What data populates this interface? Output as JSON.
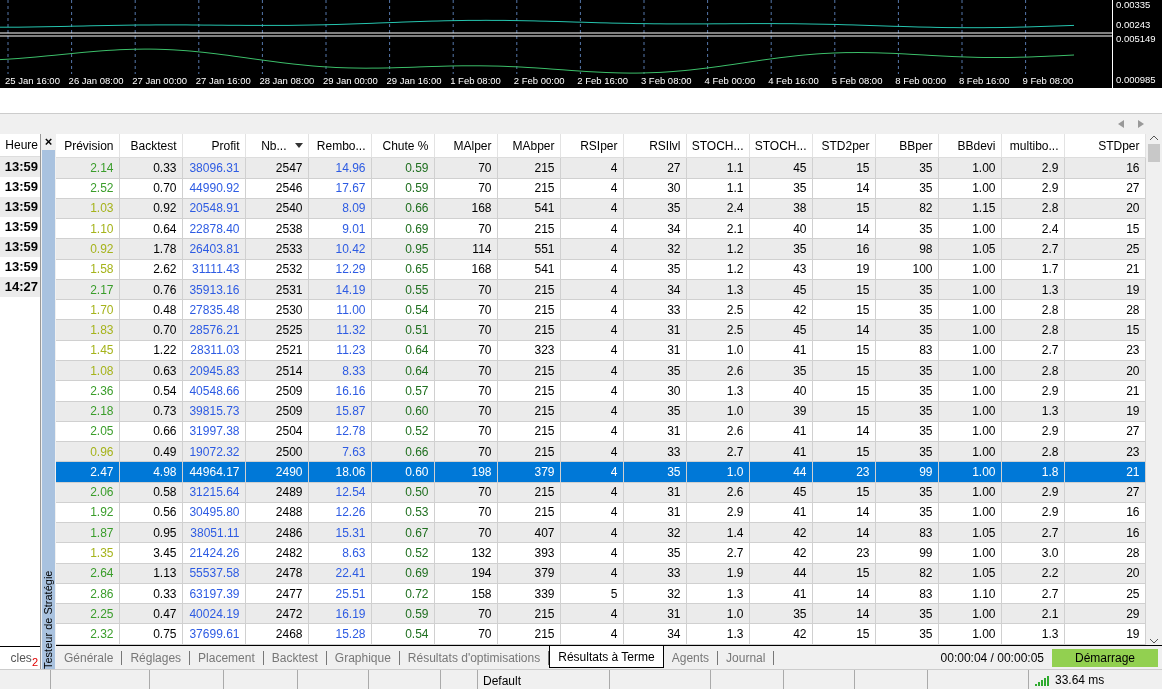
{
  "chart": {
    "time_labels": [
      "25 Jan 16:00",
      "26 Jan 08:00",
      "27 Jan 00:00",
      "27 Jan 16:00",
      "28 Jan 08:00",
      "29 Jan 00:00",
      "29 Jan 16:00",
      "1 Feb 08:00",
      "2 Feb 00:00",
      "2 Feb 16:00",
      "3 Feb 08:00",
      "4 Feb 00:00",
      "4 Feb 16:00",
      "5 Feb 08:00",
      "8 Feb 00:00",
      "8 Feb 16:00",
      "9 Feb 08:00"
    ],
    "upper_labels": [
      "0.00335",
      "0.00243"
    ],
    "lower_labels": [
      "0.005149",
      "0.000985"
    ]
  },
  "side_panel": {
    "header": "Heure",
    "times": [
      "13:59",
      "13:59",
      "13:59",
      "13:59",
      "13:59",
      "13:59",
      "14:27"
    ],
    "tab_label": "cles",
    "tab_badge": "2"
  },
  "tester": {
    "title": "Testeur de Stratégie",
    "close": "×"
  },
  "table": {
    "columns": [
      {
        "label": "Prévision",
        "sorted": false,
        "kind": "forecast"
      },
      {
        "label": "Backtest",
        "sorted": false,
        "kind": "plain"
      },
      {
        "label": "Profit",
        "sorted": false,
        "kind": "money"
      },
      {
        "label": "Nb...",
        "sorted": true,
        "kind": "plain"
      },
      {
        "label": "Rembo...",
        "sorted": false,
        "kind": "money"
      },
      {
        "label": "Chute %",
        "sorted": false,
        "kind": "ratio"
      },
      {
        "label": "MAlper",
        "sorted": false,
        "kind": "plain"
      },
      {
        "label": "MAbper",
        "sorted": false,
        "kind": "plain"
      },
      {
        "label": "RSIper",
        "sorted": false,
        "kind": "plain"
      },
      {
        "label": "RSIlvl",
        "sorted": false,
        "kind": "plain"
      },
      {
        "label": "STOCH...",
        "sorted": false,
        "kind": "plain"
      },
      {
        "label": "STOCH...",
        "sorted": false,
        "kind": "plain"
      },
      {
        "label": "STD2per",
        "sorted": false,
        "kind": "plain"
      },
      {
        "label": "BBper",
        "sorted": false,
        "kind": "plain"
      },
      {
        "label": "BBdevi",
        "sorted": false,
        "kind": "plain"
      },
      {
        "label": "multibo...",
        "sorted": false,
        "kind": "plain"
      },
      {
        "label": "STDper",
        "sorted": false,
        "kind": "plain"
      }
    ],
    "rows": [
      {
        "selected": false,
        "color": "#3a9d2a",
        "cells": [
          "2.14",
          "0.33",
          "38096.31",
          "2547",
          "14.96",
          "0.59",
          "70",
          "215",
          "4",
          "27",
          "1.1",
          "45",
          "15",
          "35",
          "1.00",
          "2.9",
          "16"
        ]
      },
      {
        "selected": false,
        "color": "#3a9d2a",
        "cells": [
          "2.52",
          "0.70",
          "44990.92",
          "2546",
          "17.67",
          "0.59",
          "70",
          "215",
          "4",
          "30",
          "1.1",
          "35",
          "14",
          "35",
          "1.00",
          "2.9",
          "27"
        ]
      },
      {
        "selected": false,
        "color": "#a5b31a",
        "cells": [
          "1.03",
          "0.92",
          "20548.91",
          "2540",
          "8.09",
          "0.66",
          "168",
          "541",
          "4",
          "35",
          "2.4",
          "38",
          "15",
          "82",
          "1.15",
          "2.8",
          "20"
        ]
      },
      {
        "selected": false,
        "color": "#a5b31a",
        "cells": [
          "1.10",
          "0.64",
          "22878.40",
          "2538",
          "9.01",
          "0.69",
          "70",
          "215",
          "4",
          "34",
          "2.1",
          "40",
          "14",
          "35",
          "1.00",
          "2.4",
          "15"
        ]
      },
      {
        "selected": false,
        "color": "#a5b31a",
        "cells": [
          "0.92",
          "1.78",
          "26403.81",
          "2533",
          "10.42",
          "0.95",
          "114",
          "551",
          "4",
          "32",
          "1.2",
          "35",
          "16",
          "98",
          "1.05",
          "2.7",
          "25"
        ]
      },
      {
        "selected": false,
        "color": "#a5b31a",
        "cells": [
          "1.58",
          "2.62",
          "31111.43",
          "2532",
          "12.29",
          "0.65",
          "168",
          "541",
          "4",
          "35",
          "1.2",
          "43",
          "19",
          "100",
          "1.00",
          "1.7",
          "21"
        ]
      },
      {
        "selected": false,
        "color": "#3a9d2a",
        "cells": [
          "2.17",
          "0.76",
          "35913.16",
          "2531",
          "14.19",
          "0.55",
          "70",
          "215",
          "4",
          "34",
          "1.3",
          "45",
          "15",
          "35",
          "1.00",
          "1.3",
          "19"
        ]
      },
      {
        "selected": false,
        "color": "#a5b31a",
        "cells": [
          "1.70",
          "0.48",
          "27835.48",
          "2530",
          "11.00",
          "0.54",
          "70",
          "215",
          "4",
          "33",
          "2.5",
          "42",
          "15",
          "35",
          "1.00",
          "2.8",
          "28"
        ]
      },
      {
        "selected": false,
        "color": "#a5b31a",
        "cells": [
          "1.83",
          "0.70",
          "28576.21",
          "2525",
          "11.32",
          "0.51",
          "70",
          "215",
          "4",
          "31",
          "2.5",
          "45",
          "14",
          "35",
          "1.00",
          "2.8",
          "15"
        ]
      },
      {
        "selected": false,
        "color": "#a5b31a",
        "cells": [
          "1.45",
          "1.22",
          "28311.03",
          "2521",
          "11.23",
          "0.64",
          "70",
          "323",
          "4",
          "31",
          "1.0",
          "41",
          "15",
          "83",
          "1.00",
          "2.7",
          "23"
        ]
      },
      {
        "selected": false,
        "color": "#a5b31a",
        "cells": [
          "1.08",
          "0.63",
          "20945.83",
          "2514",
          "8.33",
          "0.64",
          "70",
          "215",
          "4",
          "35",
          "2.6",
          "35",
          "15",
          "35",
          "1.00",
          "2.8",
          "20"
        ]
      },
      {
        "selected": false,
        "color": "#3a9d2a",
        "cells": [
          "2.36",
          "0.54",
          "40548.66",
          "2509",
          "16.16",
          "0.57",
          "70",
          "215",
          "4",
          "30",
          "1.3",
          "40",
          "15",
          "35",
          "1.00",
          "2.9",
          "21"
        ]
      },
      {
        "selected": false,
        "color": "#3a9d2a",
        "cells": [
          "2.18",
          "0.73",
          "39815.73",
          "2509",
          "15.87",
          "0.60",
          "70",
          "215",
          "4",
          "35",
          "1.0",
          "39",
          "15",
          "35",
          "1.00",
          "1.3",
          "19"
        ]
      },
      {
        "selected": false,
        "color": "#3a9d2a",
        "cells": [
          "2.05",
          "0.66",
          "31997.38",
          "2504",
          "12.78",
          "0.52",
          "70",
          "215",
          "4",
          "31",
          "2.6",
          "41",
          "14",
          "35",
          "1.00",
          "2.9",
          "27"
        ]
      },
      {
        "selected": false,
        "color": "#a5b31a",
        "cells": [
          "0.96",
          "0.49",
          "19072.32",
          "2500",
          "7.63",
          "0.66",
          "70",
          "215",
          "4",
          "33",
          "2.7",
          "41",
          "15",
          "35",
          "1.00",
          "2.8",
          "23"
        ]
      },
      {
        "selected": true,
        "cells": [
          "2.47",
          "4.98",
          "44964.17",
          "2490",
          "18.06",
          "0.60",
          "198",
          "379",
          "4",
          "35",
          "1.0",
          "44",
          "23",
          "99",
          "1.00",
          "1.8",
          "21"
        ]
      },
      {
        "selected": false,
        "color": "#3a9d2a",
        "cells": [
          "2.06",
          "0.58",
          "31215.64",
          "2489",
          "12.54",
          "0.50",
          "70",
          "215",
          "4",
          "31",
          "2.6",
          "45",
          "15",
          "35",
          "1.00",
          "2.9",
          "27"
        ]
      },
      {
        "selected": false,
        "color": "#3a9d2a",
        "cells": [
          "1.92",
          "0.56",
          "30495.80",
          "2488",
          "12.26",
          "0.53",
          "70",
          "215",
          "4",
          "31",
          "2.9",
          "41",
          "14",
          "35",
          "1.00",
          "2.9",
          "16"
        ]
      },
      {
        "selected": false,
        "color": "#3a9d2a",
        "cells": [
          "1.87",
          "0.95",
          "38051.11",
          "2486",
          "15.31",
          "0.67",
          "70",
          "407",
          "4",
          "32",
          "1.4",
          "42",
          "14",
          "83",
          "1.05",
          "2.7",
          "16"
        ]
      },
      {
        "selected": false,
        "color": "#a5b31a",
        "cells": [
          "1.35",
          "3.45",
          "21424.26",
          "2482",
          "8.63",
          "0.52",
          "132",
          "393",
          "4",
          "35",
          "2.7",
          "42",
          "23",
          "99",
          "1.00",
          "3.0",
          "28"
        ]
      },
      {
        "selected": false,
        "color": "#3a9d2a",
        "cells": [
          "2.64",
          "1.13",
          "55537.58",
          "2478",
          "22.41",
          "0.69",
          "194",
          "379",
          "4",
          "33",
          "1.9",
          "44",
          "15",
          "82",
          "1.05",
          "2.2",
          "20"
        ]
      },
      {
        "selected": false,
        "color": "#3a9d2a",
        "cells": [
          "2.86",
          "0.33",
          "63197.39",
          "2477",
          "25.51",
          "0.72",
          "158",
          "339",
          "5",
          "32",
          "1.3",
          "41",
          "14",
          "83",
          "1.10",
          "2.7",
          "25"
        ]
      },
      {
        "selected": false,
        "color": "#3a9d2a",
        "cells": [
          "2.25",
          "0.47",
          "40024.19",
          "2472",
          "16.19",
          "0.59",
          "70",
          "215",
          "4",
          "31",
          "1.0",
          "35",
          "14",
          "35",
          "1.00",
          "2.1",
          "29"
        ]
      },
      {
        "selected": false,
        "color": "#3a9d2a",
        "cells": [
          "2.32",
          "0.75",
          "37699.61",
          "2468",
          "15.28",
          "0.54",
          "70",
          "215",
          "4",
          "34",
          "1.3",
          "42",
          "15",
          "35",
          "1.00",
          "1.3",
          "19"
        ]
      }
    ]
  },
  "tabs": [
    {
      "label": "Générale",
      "selected": false
    },
    {
      "label": "Réglages",
      "selected": false
    },
    {
      "label": "Placement",
      "selected": false
    },
    {
      "label": "Backtest",
      "selected": false
    },
    {
      "label": "Graphique",
      "selected": false
    },
    {
      "label": "Résultats d'optimisations",
      "selected": false
    },
    {
      "label": "Résultats à Terme",
      "selected": true
    },
    {
      "label": "Agents",
      "selected": false
    },
    {
      "label": "Journal",
      "selected": false
    }
  ],
  "timer": "00:00:04 / 00:00:05",
  "start_button": "Démarrage",
  "status_bar": {
    "profile": "Default",
    "ping": "33.64 ms"
  }
}
